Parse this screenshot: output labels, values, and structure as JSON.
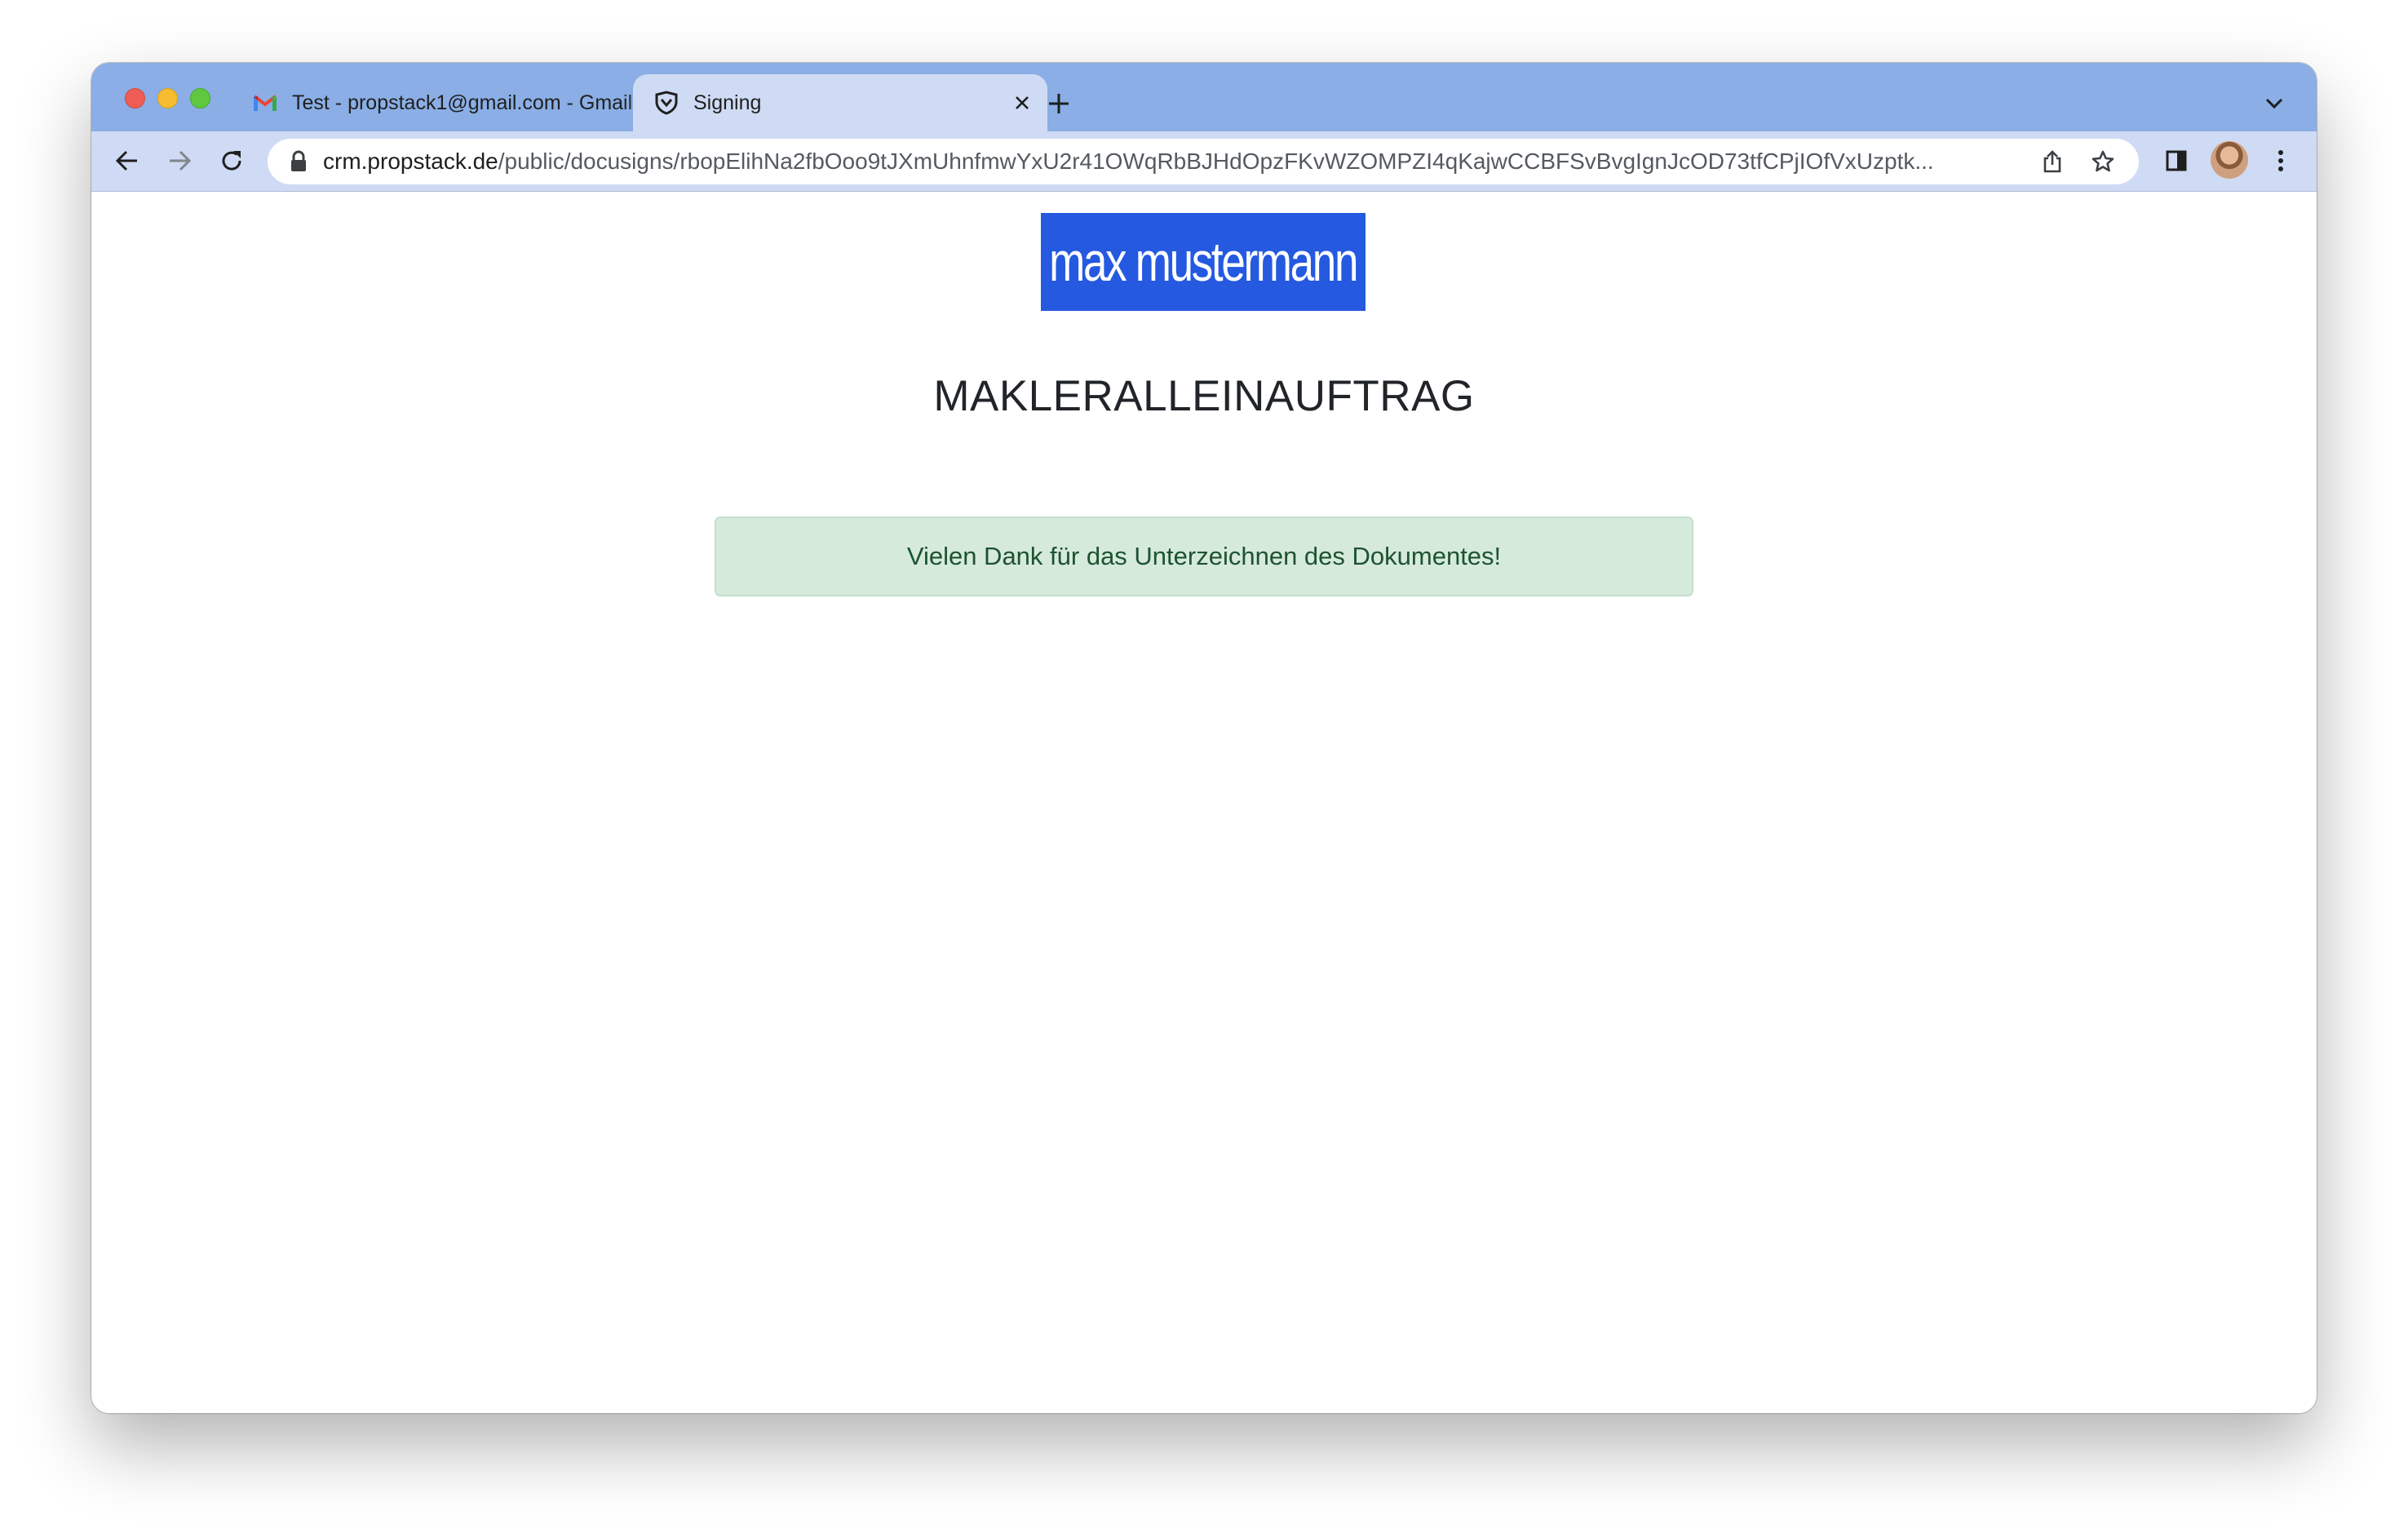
{
  "browser": {
    "tabs": [
      {
        "title": "Test - propstack1@gmail.com - Gmail",
        "icon": "gmail-icon",
        "active": false
      },
      {
        "title": "Signing",
        "icon": "shield-icon",
        "active": true
      }
    ],
    "new_tab_icon": "plus-icon",
    "address_bar": {
      "host": "crm.propstack.de",
      "path": "/public/docusigns/rbopElihNa2fbOoo9tJXmUhnfmwYxU2r41OWqRbBJHdOpzFKvWZOMPZI4qKajwCCBFSvBvgIgnJcOD73tfCPjIOfVxUzptk..."
    },
    "toolbar_icons": [
      "back-icon",
      "forward-icon",
      "reload-icon",
      "lock-icon",
      "share-icon",
      "bookmark-star-icon",
      "side-panel-icon",
      "avatar",
      "menu-icon"
    ]
  },
  "page": {
    "logo_text": "max mustermann",
    "title": "MAKLERALLEINAUFTRAG",
    "alert_message": "Vielen Dank für das Unterzeichnen des Dokumentes!"
  },
  "colors": {
    "tabstrip": "#8aaee5",
    "toolbar": "#cfdbf4",
    "logo_bg": "#2459e0",
    "alert_bg": "#d6eadc",
    "alert_text": "#1d5331"
  }
}
